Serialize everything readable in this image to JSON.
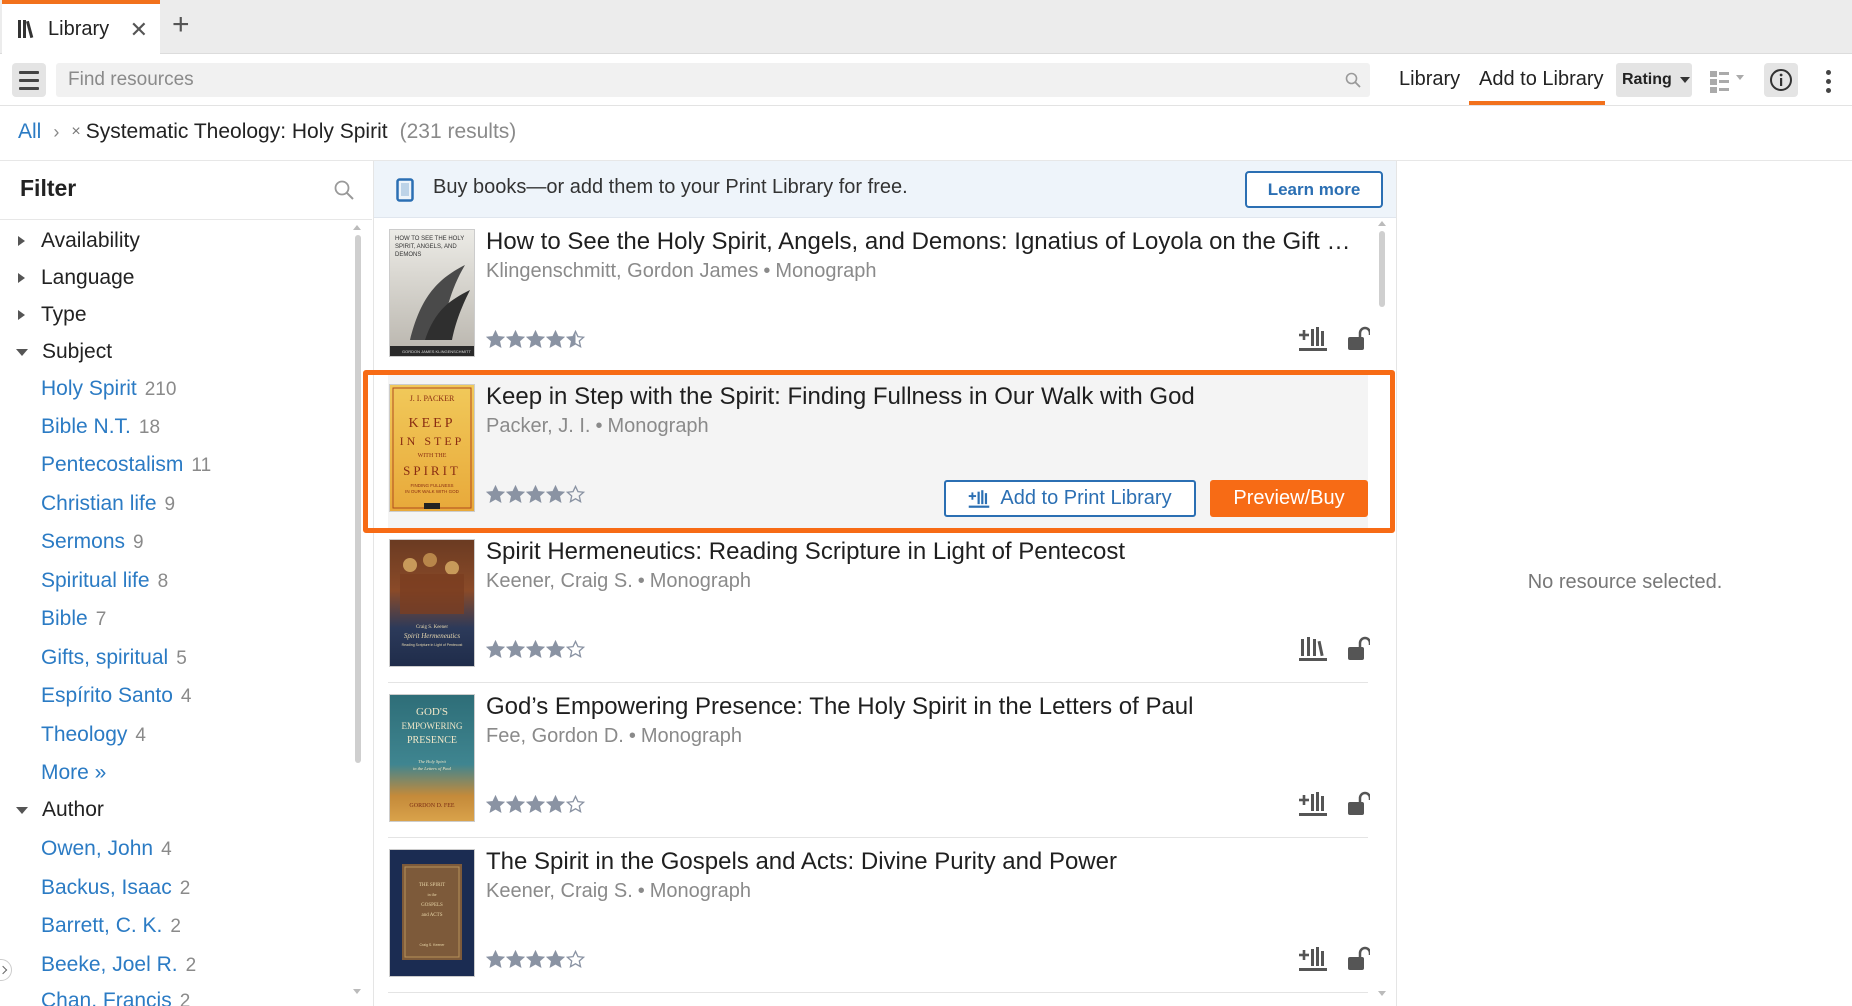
{
  "tab": {
    "label": "Library",
    "close": "✕",
    "add": "+"
  },
  "toolbar": {
    "search_placeholder": "Find resources",
    "library_link": "Library",
    "add_to_library_link": "Add to Library",
    "sort_label": "Rating"
  },
  "breadcrumb": {
    "all": "All",
    "separator": "›",
    "remove": "×",
    "current": "Systematic Theology: Holy Spirit",
    "count": "(231 results)"
  },
  "filter": {
    "title": "Filter",
    "groups": {
      "availability": "Availability",
      "language": "Language",
      "type": "Type",
      "subject": "Subject",
      "author": "Author"
    },
    "subjects": [
      {
        "label": "Holy Spirit",
        "count": "210"
      },
      {
        "label": "Bible N.T.",
        "count": "18"
      },
      {
        "label": "Pentecostalism",
        "count": "11"
      },
      {
        "label": "Christian life",
        "count": "9"
      },
      {
        "label": "Sermons",
        "count": "9"
      },
      {
        "label": "Spiritual life",
        "count": "8"
      },
      {
        "label": "Bible",
        "count": "7"
      },
      {
        "label": "Gifts, spiritual",
        "count": "5"
      },
      {
        "label": "Espírito Santo",
        "count": "4"
      },
      {
        "label": "Theology",
        "count": "4"
      }
    ],
    "more": "More »",
    "authors": [
      {
        "label": "Owen, John",
        "count": "4"
      },
      {
        "label": "Backus, Isaac",
        "count": "2"
      },
      {
        "label": "Barrett, C. K.",
        "count": "2"
      },
      {
        "label": "Beeke, Joel R.",
        "count": "2"
      },
      {
        "label": "Chan, Francis",
        "count": "2"
      }
    ]
  },
  "promo": {
    "text": "Buy books—or add them to your Print Library for free.",
    "button": "Learn more"
  },
  "results": [
    {
      "title": "How to See the Holy Spirit, Angels, and Demons: Ignatius of Loyola on the Gift of Discernment",
      "author": "Klingenschmitt, Gordon James",
      "type": "Monograph",
      "rating": 4.5,
      "cover_text": [
        "HOW TO SEE THE HOLY",
        "SPIRIT, ANGELS, AND",
        "DEMONS",
        "GORDON JAMES KLINGENSCHMITT"
      ]
    },
    {
      "title": "Keep in Step with the Spirit: Finding Fullness in Our Walk with God",
      "author": "Packer, J. I.",
      "type": "Monograph",
      "rating": 4,
      "selected": true,
      "cover_text": [
        "J. I. PACKER",
        "KEEP",
        "IN STEP",
        "WITH THE",
        "SPIRIT",
        "FINDING FULLNESS",
        "IN OUR WALK WITH GOD"
      ]
    },
    {
      "title": "Spirit Hermeneutics: Reading Scripture in Light of Pentecost",
      "author": "Keener, Craig S.",
      "type": "Monograph",
      "rating": 4,
      "cover_text": [
        "Craig S. Keener",
        "Spirit Hermeneutics",
        "Reading Scripture in Light of Pentecost"
      ]
    },
    {
      "title": "God’s Empowering Presence: The Holy Spirit in the Letters of Paul",
      "author": "Fee, Gordon D.",
      "type": "Monograph",
      "rating": 4,
      "cover_text": [
        "GOD'S",
        "EMPOWERING",
        "PRESENCE",
        "The Holy Spirit",
        "in the Letters of Paul",
        "GORDON D. FEE"
      ]
    },
    {
      "title": "The Spirit in the Gospels and Acts: Divine Purity and Power",
      "author": "Keener, Craig S.",
      "type": "Monograph",
      "rating": 4,
      "cover_text": [
        "THE SPIRIT",
        "in the",
        "GOSPELS",
        "and ACTS",
        "Craig S. Keener"
      ]
    }
  ],
  "selected_actions": {
    "add_print": "Add to Print Library",
    "preview_buy": "Preview/Buy"
  },
  "detail": {
    "empty": "No resource selected."
  },
  "colors": {
    "accent": "#f76b15",
    "link": "#2b7bc4",
    "button_blue": "#2b6fb3",
    "star": "#8a93a3"
  }
}
